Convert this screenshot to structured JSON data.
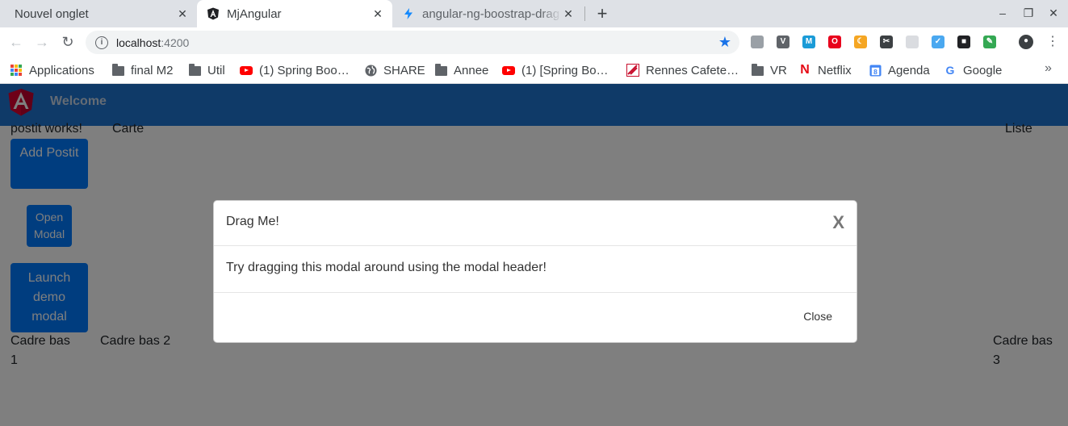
{
  "browser": {
    "tabs": [
      {
        "title": "Nouvel onglet",
        "active": false
      },
      {
        "title": "MjAngular",
        "active": true
      },
      {
        "title": "angular-ng-boostrap-drag",
        "active": false
      }
    ],
    "close_glyph": "✕",
    "new_tab_glyph": "+",
    "window_controls": {
      "minimize": "–",
      "maximize": "❐",
      "close": "✕"
    },
    "address": {
      "host": "localhost",
      "port": ":4200",
      "info_glyph": "i",
      "star_glyph": "★"
    },
    "nav": {
      "back": "←",
      "forward": "→",
      "reload": "↻"
    },
    "menu_glyph": "⋮",
    "extensions": [
      {
        "name": "shield-extension-icon",
        "color": "#9aa0a6",
        "glyph": ""
      },
      {
        "name": "v-extension-icon",
        "color": "#5f6368",
        "glyph": "V"
      },
      {
        "name": "m-extension-icon",
        "color": "#1a9bd7",
        "glyph": "M"
      },
      {
        "name": "opera-extension-icon",
        "color": "#e8001c",
        "glyph": "O"
      },
      {
        "name": "moon-extension-icon",
        "color": "#f5a623",
        "glyph": "☾"
      },
      {
        "name": "tool-extension-icon",
        "color": "#3c4043",
        "glyph": "✂"
      },
      {
        "name": "grid-extension-icon",
        "color": "#dadce0",
        "glyph": ""
      },
      {
        "name": "bird-extension-icon",
        "color": "#4aa8f0",
        "glyph": "✓"
      },
      {
        "name": "cube-extension-icon",
        "color": "#202124",
        "glyph": "■"
      },
      {
        "name": "color-extension-icon",
        "color": "#34a853",
        "glyph": "✎"
      },
      {
        "name": "profile-avatar",
        "color": "#3c4043",
        "glyph": "●"
      }
    ]
  },
  "bookmarks": {
    "items": [
      {
        "label": "Applications",
        "icon": "apps-grid-icon"
      },
      {
        "label": "final M2",
        "icon": "folder-icon"
      },
      {
        "label": "Util",
        "icon": "folder-icon"
      },
      {
        "label": "(1) Spring Boo…",
        "icon": "youtube-icon"
      },
      {
        "label": "SHARE",
        "icon": "globe-icon"
      },
      {
        "label": "Annee",
        "icon": "folder-icon"
      },
      {
        "label": "(1) [Spring Bo…",
        "icon": "youtube-icon"
      },
      {
        "label": "Rennes Cafete…",
        "icon": "cafeteria-icon"
      },
      {
        "label": "VR",
        "icon": "folder-icon"
      },
      {
        "label": "Netflix",
        "icon": "netflix-icon"
      },
      {
        "label": "Agenda",
        "icon": "calendar-icon"
      },
      {
        "label": "Google",
        "icon": "google-icon"
      }
    ],
    "more_glyph": "»"
  },
  "app": {
    "navbar": {
      "brand": "Welcome"
    },
    "postit_text": "postit works!",
    "carte": "Carte",
    "liste": "Liste",
    "buttons": {
      "add_postit": "Add Postit",
      "open_modal": "Open Modal",
      "launch_demo": "Launch demo modal"
    },
    "cadres": {
      "bas1": "Cadre bas 1",
      "bas2": "Cadre bas 2",
      "bas3": "Cadre bas 3"
    }
  },
  "modal": {
    "title": "Drag Me!",
    "close_x": "X",
    "body": "Try dragging this modal around using the modal header!",
    "footer_close": "Close"
  },
  "colors": {
    "navbar": "#1f75d0",
    "primary": "#007bff",
    "angular_red": "#dd0031"
  }
}
